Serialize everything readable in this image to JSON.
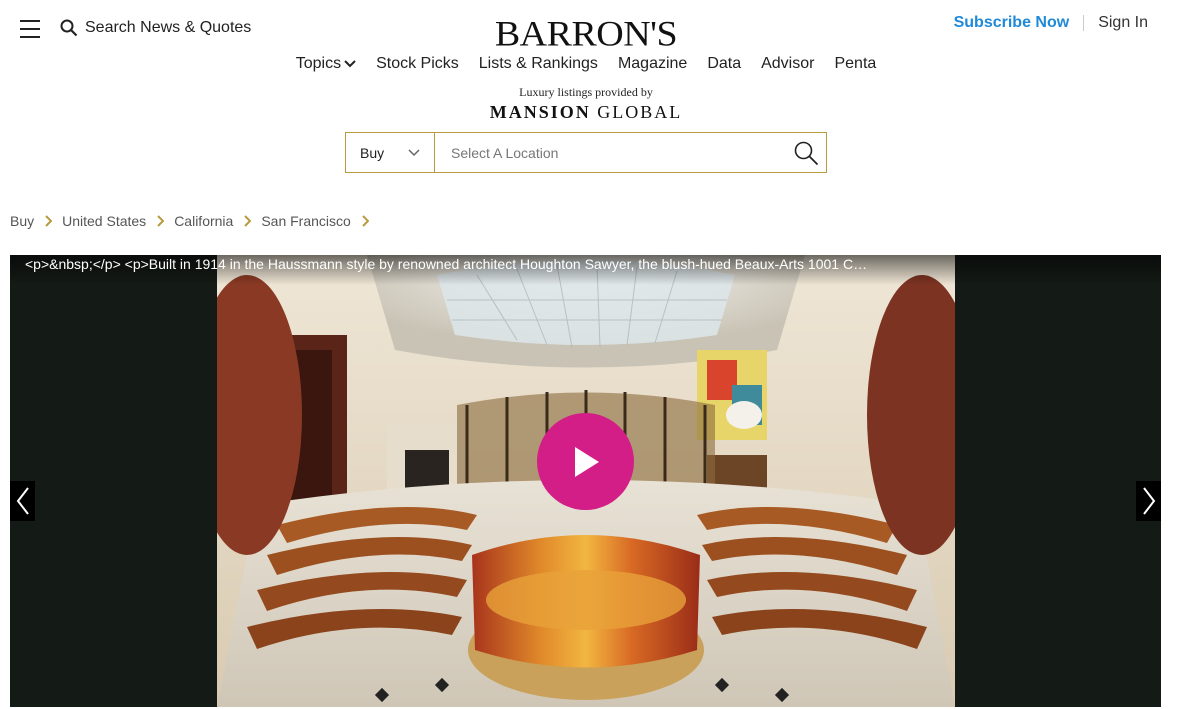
{
  "header": {
    "search_label": "Search News & Quotes",
    "logo_text": "BARRON'S",
    "subscribe_label": "Subscribe Now",
    "signin_label": "Sign In"
  },
  "nav": {
    "items": [
      "Topics",
      "Stock Picks",
      "Lists & Rankings",
      "Magazine",
      "Data",
      "Advisor",
      "Penta"
    ]
  },
  "mansion_global": {
    "subtitle": "Luxury listings provided by",
    "logo_bold": "MANSION",
    "logo_light": "GLOBAL"
  },
  "listing_search": {
    "mode": "Buy",
    "placeholder": "Select A Location"
  },
  "breadcrumb": {
    "items": [
      "Buy",
      "United States",
      "California",
      "San Francisco"
    ]
  },
  "gallery": {
    "caption": "<p>&nbsp;</p> <p>Built in 1914 in the Haussmann style by renowned architect Houghton Sawyer, the blush-hued Beaux-Arts 1001 C…"
  },
  "colors": {
    "accent_gold": "#b79b3e",
    "subscribe_blue": "#1f8ad8",
    "play_magenta": "#d21e86",
    "gallery_bg": "#141a16"
  },
  "icons": {
    "menu": "hamburger-icon",
    "search": "search-icon",
    "chevron": "chevron-right-icon",
    "play": "play-icon"
  }
}
